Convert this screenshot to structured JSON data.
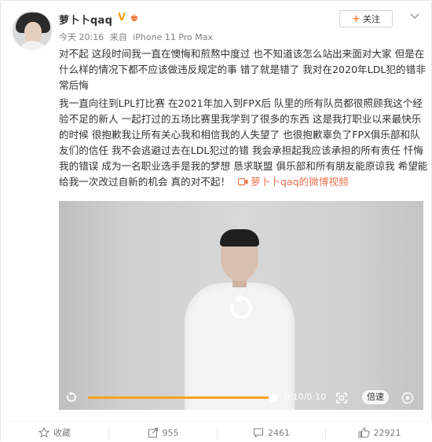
{
  "post": {
    "author": {
      "name": "萝卜卜qaq",
      "vip_badge": "V",
      "level_badge": "♚"
    },
    "meta": {
      "time": "今天 20:16",
      "source_prefix": "来自",
      "device": "iPhone 11 Pro Max"
    },
    "follow_label": "关注",
    "content": {
      "paragraph_1": "对不起 这段时间我一直在懊悔和煎熬中度过 也不知道该怎么站出来面对大家 但是在什么样的情况下都不应该做违反规定的事 错了就是错了 我对在2020年LDL犯的错非常后悔",
      "paragraph_2": "我一直向往到LPL打比赛 在2021年加入到FPX后 队里的所有队员都很照顾我这个经验不足的新人 一起打过的五场比赛里我学到了很多的东西 这是我打职业以来最快乐的时候 很抱歉我让所有关心我和相信我的人失望了 也很抱歉辜负了FPX俱乐部和队友们的信任 我不会逃避过去在LDL犯过的错 我会承担起我应该承担的所有责任 忏悔我的错误 成为一名职业选手是我的梦想 恳求联盟 俱乐部和所有朋友能原谅我 希望能给我一次改过自新的机会 真的对不起！",
      "video_link": "萝卜卜qaq的微博视频"
    },
    "video": {
      "time_display": "0:10/0:10",
      "progress": 1.0,
      "speed_label": "倍速"
    },
    "actions": {
      "favorite_label": "收藏",
      "repost_count": "955",
      "comment_count": "2461",
      "like_count": "22921"
    },
    "colors": {
      "accent_orange": "#eb7350",
      "progress_orange": "#f7a21b",
      "text": "#333333",
      "muted": "#808080"
    }
  }
}
